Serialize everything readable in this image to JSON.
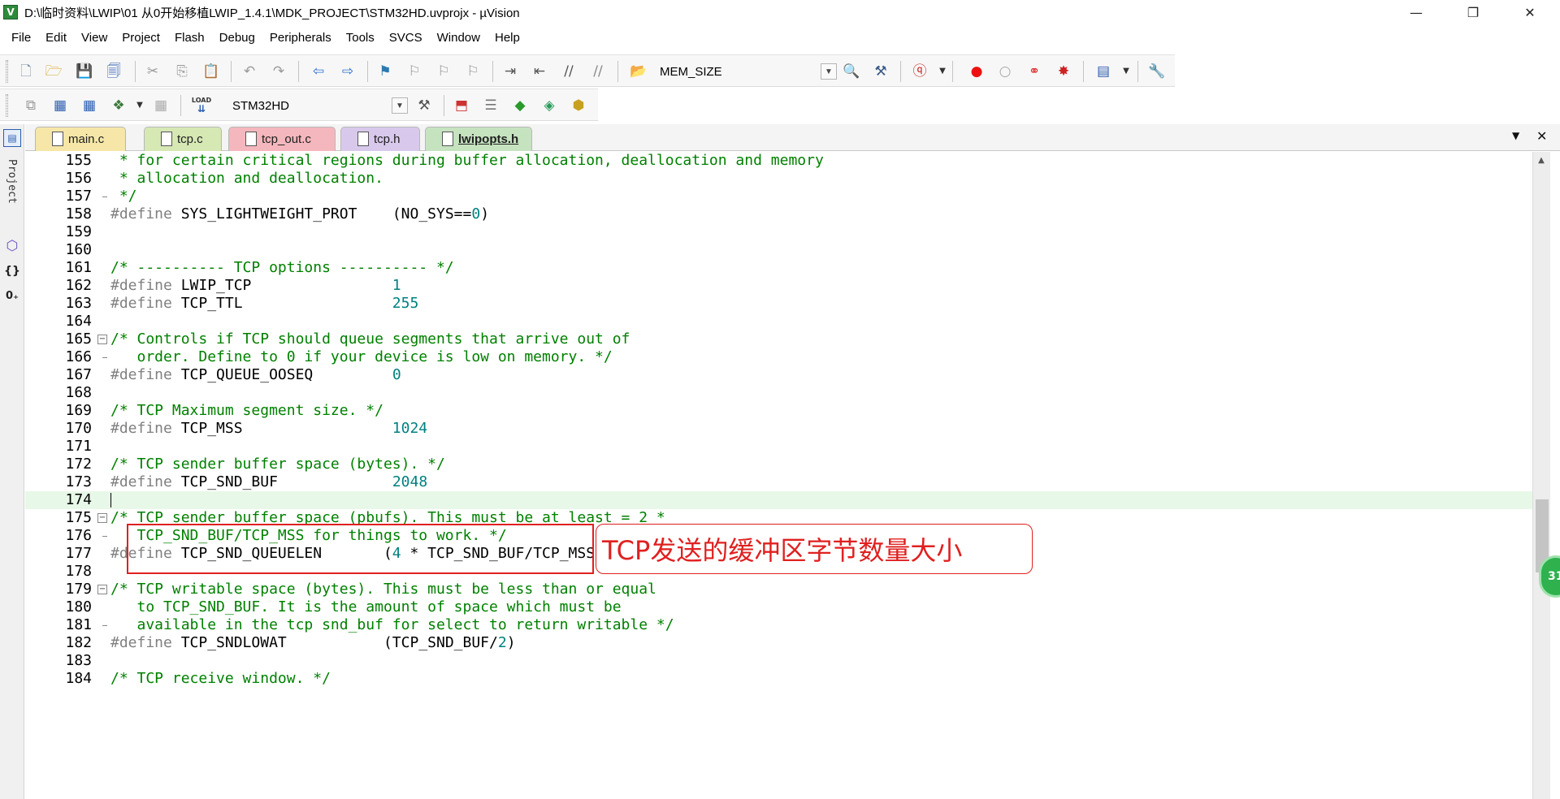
{
  "window": {
    "title": "D:\\临时资料\\LWIP\\01 从0开始移植LWIP_1.4.1\\MDK_PROJECT\\STM32HD.uvprojx - µVision",
    "app_icon": "V",
    "minimize": "—",
    "restore": "❐",
    "close": "✕"
  },
  "menu": [
    "File",
    "Edit",
    "View",
    "Project",
    "Flash",
    "Debug",
    "Peripherals",
    "Tools",
    "SVCS",
    "Window",
    "Help"
  ],
  "toolbar1": {
    "find_combo_value": "MEM_SIZE"
  },
  "toolbar2": {
    "target_combo_value": "STM32HD",
    "load_label": "LOAD"
  },
  "left_panel": {
    "project_label": "Project"
  },
  "tabs": [
    {
      "label": "main.c",
      "color": "#f6e7a8",
      "active": false
    },
    {
      "label": "tcp.c",
      "color": "#d6e8b4",
      "active": false
    },
    {
      "label": "tcp_out.c",
      "color": "#f4b7bd",
      "active": false
    },
    {
      "label": "tcp.h",
      "color": "#d8c9ec",
      "active": false
    },
    {
      "label": "lwipopts.h",
      "color": "#c6e3c0",
      "active": true
    }
  ],
  "tabbar_controls": {
    "dropdown": "▼",
    "close": "✕"
  },
  "editor": {
    "lines": [
      {
        "n": "155",
        "t": " * for certain critical regions during buffer allocation, deallocation and memory"
      },
      {
        "n": "156",
        "t": " * allocation and deallocation."
      },
      {
        "n": "157",
        "t": " */"
      },
      {
        "n": "158",
        "t": "#define SYS_LIGHTWEIGHT_PROT    (NO_SYS==0)"
      },
      {
        "n": "159",
        "t": ""
      },
      {
        "n": "160",
        "t": ""
      },
      {
        "n": "161",
        "t": "/* ---------- TCP options ---------- */"
      },
      {
        "n": "162",
        "t": "#define LWIP_TCP                1"
      },
      {
        "n": "163",
        "t": "#define TCP_TTL                 255"
      },
      {
        "n": "164",
        "t": ""
      },
      {
        "n": "165",
        "t": "/* Controls if TCP should queue segments that arrive out of"
      },
      {
        "n": "166",
        "t": "   order. Define to 0 if your device is low on memory. */"
      },
      {
        "n": "167",
        "t": "#define TCP_QUEUE_OOSEQ         0"
      },
      {
        "n": "168",
        "t": ""
      },
      {
        "n": "169",
        "t": "/* TCP Maximum segment size. */"
      },
      {
        "n": "170",
        "t": "#define TCP_MSS                 1024"
      },
      {
        "n": "171",
        "t": ""
      },
      {
        "n": "172",
        "t": "/* TCP sender buffer space (bytes). */"
      },
      {
        "n": "173",
        "t": "#define TCP_SND_BUF             2048"
      },
      {
        "n": "174",
        "t": ""
      },
      {
        "n": "175",
        "t": "/* TCP sender buffer space (pbufs). This must be at least = 2 *"
      },
      {
        "n": "176",
        "t": "   TCP_SND_BUF/TCP_MSS for things to work. */"
      },
      {
        "n": "177",
        "t": "#define TCP_SND_QUEUELEN       (4 * TCP_SND_BUF/TCP_MSS)"
      },
      {
        "n": "178",
        "t": ""
      },
      {
        "n": "179",
        "t": "/* TCP writable space (bytes). This must be less than or equal"
      },
      {
        "n": "180",
        "t": "   to TCP_SND_BUF. It is the amount of space which must be"
      },
      {
        "n": "181",
        "t": "   available in the tcp snd_buf for select to return writable */"
      },
      {
        "n": "182",
        "t": "#define TCP_SNDLOWAT           (TCP_SND_BUF/2)"
      },
      {
        "n": "183",
        "t": ""
      },
      {
        "n": "184",
        "t": "/* TCP receive window. */"
      }
    ],
    "current_line": "174",
    "current_line_color": "#e8f8e8"
  },
  "annotation": {
    "callout_text": "TCP发送的缓冲区字节数量大小",
    "color": "#e02020"
  },
  "badge": {
    "text": "31"
  },
  "colors": {
    "comment": "#008000",
    "preprocessor": "#808080",
    "number": "#008080"
  }
}
